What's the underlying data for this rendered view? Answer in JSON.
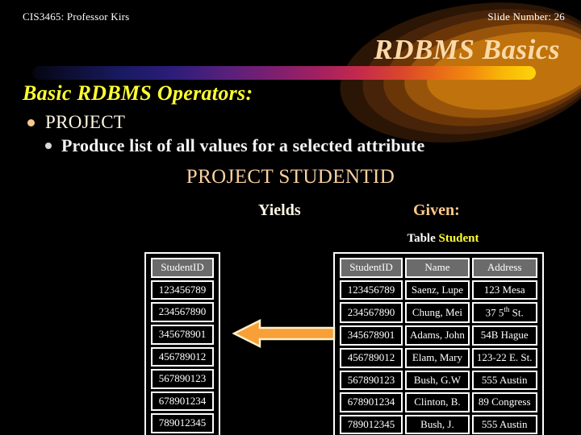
{
  "header": {
    "left": "CIS3465: Professor Kirs",
    "right": "Slide Number: 26"
  },
  "title": "RDBMS Basics",
  "body": {
    "heading": "Basic RDBMS Operators:",
    "bullet_level1": "PROJECT",
    "bullet_level2": "Produce list of all values for a selected attribute",
    "project_statement": "PROJECT STUDENTID",
    "yields_label": "Yields",
    "given_label": "Given:"
  },
  "table_caption": {
    "prefix": "Table ",
    "name": "Student"
  },
  "result_table": {
    "headers": [
      "StudentID"
    ],
    "rows": [
      [
        "123456789"
      ],
      [
        "234567890"
      ],
      [
        "345678901"
      ],
      [
        "456789012"
      ],
      [
        "567890123"
      ],
      [
        "678901234"
      ],
      [
        "789012345"
      ]
    ]
  },
  "source_table": {
    "headers": [
      "StudentID",
      "Name",
      "Address"
    ],
    "rows": [
      [
        "123456789",
        "Saenz, Lupe",
        "123 Mesa"
      ],
      [
        "234567890",
        "Chung, Mei",
        "37 5|th| St."
      ],
      [
        "345678901",
        "Adams, John",
        "54B Hague"
      ],
      [
        "456789012",
        "Elam, Mary",
        "123-22 E. St."
      ],
      [
        "567890123",
        "Bush, G.W",
        "555 Austin"
      ],
      [
        "678901234",
        "Clinton, B.",
        "89 Congress"
      ],
      [
        "789012345",
        "Bush, J.",
        "555 Austin"
      ]
    ]
  },
  "arrow": {
    "direction": "left",
    "fill": "#f7a038",
    "stroke": "#fdf0c8"
  },
  "colors": {
    "background": "#000000",
    "title": "#fbd9a8",
    "heading": "#ffff33",
    "accent_highlight": "#ffff33",
    "body_text": "#fdf6e4",
    "given": "#fbc98c",
    "table_header_bg": "#6b6b6b"
  }
}
